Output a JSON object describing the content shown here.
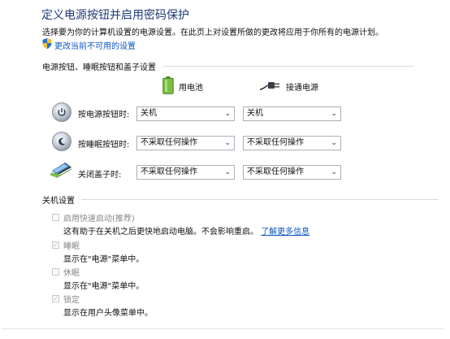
{
  "header": {
    "title": "定义电源按钮并启用密码保护",
    "description": "选择要为你的计算机设置的电源设置。在此页上对设置所做的更改将应用于你所有的电源计划。",
    "change_link": "更改当前不可用的设置"
  },
  "power_buttons": {
    "section_title": "电源按钮、睡眠按钮和盖子设置",
    "columns": {
      "battery": "用电池",
      "plugged": "接通电源"
    },
    "rows": [
      {
        "label": "按电源按钮时:",
        "battery": "关机",
        "plugged": "关机",
        "icon": "power-button-icon"
      },
      {
        "label": "按睡眠按钮时:",
        "battery": "不采取任何操作",
        "plugged": "不采取任何操作",
        "icon": "sleep-button-icon"
      },
      {
        "label": "关闭盖子时:",
        "battery": "不采取任何操作",
        "plugged": "不采取任何操作",
        "icon": "laptop-lid-icon"
      }
    ]
  },
  "shutdown": {
    "section_title": "关机设置",
    "items": [
      {
        "label": "启用快速启动(推荐)",
        "desc": "这有助于在关机之后更快地启动电脑。不会影响重启。",
        "link": "了解更多信息",
        "checked": false
      },
      {
        "label": "睡眠",
        "desc": "显示在\"电源\"菜单中。",
        "checked": true
      },
      {
        "label": "休眠",
        "desc": "显示在\"电源\"菜单中。",
        "checked": false
      },
      {
        "label": "锁定",
        "desc": "显示在用户头像菜单中。",
        "checked": true
      }
    ]
  }
}
